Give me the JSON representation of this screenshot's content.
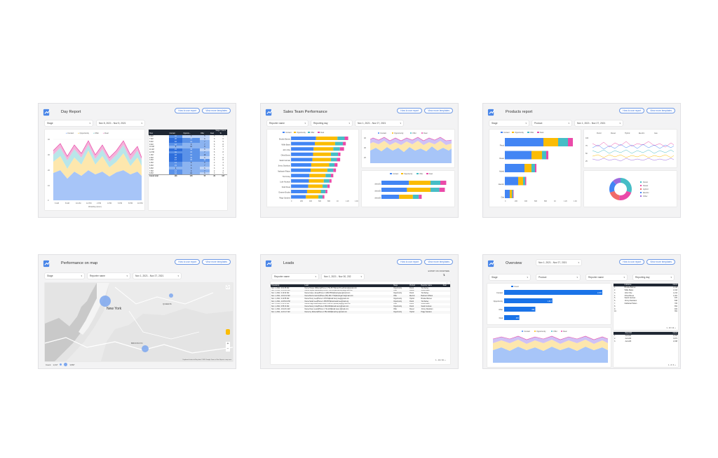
{
  "colors": {
    "contact": "#4285f4",
    "opportunity": "#fbbc04",
    "offer": "#46bdc6",
    "deal": "#ea4aa9",
    "dark_header": "#1f2733",
    "brand": "#3b73d8"
  },
  "common": {
    "how_to_use": "How to use report",
    "view_more": "View more templates"
  },
  "day_report": {
    "title": "Day Report",
    "stage": "Stage",
    "date_range": "Nov 8, 2021 - Nov 5, 2021",
    "legend": [
      "Contact",
      "Opportunity",
      "Offer",
      "Deal"
    ],
    "yticks": [
      "40",
      "30",
      "20",
      "10",
      "0"
    ],
    "xticks": [
      "6 AM",
      "8 AM",
      "10 AM",
      "12 PM",
      "2 PM",
      "4 PM",
      "6 PM",
      "8 PM",
      "10 PM"
    ],
    "xlabel": "Weekday (Hour)",
    "table_title": "Stage / Count",
    "headers": [
      "Hour",
      "Contact",
      "Opportu...",
      "Offer",
      "Deal",
      "To"
    ],
    "rows": [
      [
        "6 AM",
        "11",
        "3",
        "5",
        "3",
        "4"
      ],
      [
        "7 AM",
        "20",
        "14",
        "6",
        "3",
        "6"
      ],
      [
        "8 AM",
        "16",
        "14",
        "7",
        "5",
        "5"
      ],
      [
        "9 AM",
        "12",
        "8",
        "7",
        "5",
        "8"
      ],
      [
        "10 AM",
        "9",
        "10",
        "8",
        "4",
        "6"
      ],
      [
        "11 AM",
        "21",
        "11",
        "6",
        "6",
        "7"
      ],
      [
        "12 PM",
        "11",
        "15",
        "7",
        "5",
        "8"
      ],
      [
        "1 PM",
        "18",
        "12",
        "10",
        "6",
        "7"
      ],
      [
        "2 PM",
        "18",
        "11",
        "6",
        "5",
        "8"
      ],
      [
        "3 PM",
        "17",
        "15",
        "11",
        "4",
        "8"
      ],
      [
        "4 PM",
        "14",
        "8",
        "9",
        "2",
        "4"
      ],
      [
        "5 PM",
        "15",
        "9",
        "7",
        "3",
        "5"
      ],
      [
        "6 PM",
        "9",
        "8",
        "6",
        "3",
        "4"
      ],
      [
        "7 PM",
        "13",
        "9",
        "7",
        "2",
        "3"
      ],
      [
        "8 PM",
        "12",
        "10",
        "6",
        "3",
        "5"
      ]
    ],
    "total": [
      "Grand total",
      "138",
      "105",
      "55",
      "29",
      "447"
    ]
  },
  "sales_team": {
    "title": "Sales Team Performance",
    "filters": [
      "Reporter name",
      "Reporting day",
      "Nov 1, 2021 - Nov 27, 2021"
    ],
    "legend": [
      "Contact",
      "Opportunity",
      "Offer",
      "Deal"
    ],
    "names": [
      "Brooke Barnes",
      "Willie Bates",
      "John Chie",
      "Olivia Bones",
      "Sarah Gutman",
      "Jimmy Davidson",
      "Nathaniel Patten",
      "Tori Forley",
      "Luke Houston",
      "Noah Fleas",
      "Deanne Brooks",
      "Paige Sanders"
    ],
    "xticks": [
      "0",
      "200",
      "400",
      "600",
      "800",
      "1K",
      "1.2K",
      "1.4K"
    ],
    "line_yticks": [
      "40",
      "30",
      "20"
    ],
    "bar2_names": [
      "demo01",
      "demo02",
      "demo03"
    ]
  },
  "products": {
    "title": "Products report",
    "filters": [
      "Stage",
      "Product",
      "Nov 1, 2021 - Nov 27, 2021"
    ],
    "legend": [
      "Contact",
      "Opportunity",
      "Offer",
      "Deal"
    ],
    "names": [
      "Petrol",
      "Diesel",
      "Hybrid",
      "Electric",
      "Gas"
    ],
    "xticks": [
      "0",
      "200",
      "400",
      "600",
      "800",
      "1K",
      "1.2K",
      "1.4K"
    ],
    "line_legend": [
      "Petrol",
      "Diesel",
      "Hybrid",
      "Electric",
      "Gas"
    ],
    "line_yticks": [
      "100",
      "75",
      "50",
      "25"
    ],
    "donut_legend": [
      "Petrol",
      "Diesel",
      "Hybrid",
      "Electric",
      "Other"
    ]
  },
  "map_report": {
    "title": "Performance on map",
    "filters": [
      "Stage",
      "Reporter name",
      "Nov 1, 2021 - Nov 27, 2021"
    ],
    "labels": [
      "New York",
      "QUEENS",
      "BROOKLYN"
    ],
    "footer_count": "Count",
    "footer_range": "1,017",
    "footer_max": "3,897",
    "attribution": "Keyboard shortcuts   Map data ©2021 Google   Terms of Use   Report a map error"
  },
  "leads": {
    "title": "Leads",
    "filters": [
      "Reporter name",
      "Nov 1, 2021 - Nov 30, 202"
    ],
    "export_hint": "EXPORT CSV FROM HERE",
    "headers": [
      "Timestamp",
      "Lead",
      "Stage",
      "Product",
      "Reporter name",
      "Deal"
    ],
    "rows": [
      [
        "Nov 1, 2021, 9:01:35 AM",
        "Name:Harper Williams|Phone:1 752-5577|Email:hh.adrhams@gmail.com",
        "Opportunity",
        "Petrol",
        "Tod Farley",
        ""
      ],
      [
        "Nov 1, 2021, 10:18:20 AM",
        "Name:Sophie Alexander|Phone:1 584-215|Email:sophie@mail.com",
        "Offer",
        "Diesel",
        "Willie Bates",
        ""
      ],
      [
        "Nov 1, 2021, 9:10:32 AM",
        "Name:Grace Jones|Phone:1 4482-5551|Email:grace@mail.com",
        "Opportunity",
        "Petrol",
        "Tod Farley",
        ""
      ],
      [
        "Nov 1, 2021, 11:02:12 AM",
        "Name:Morris Garmin|Phone:(55) 481-7741|Email:garmin@mail.com",
        "Offer",
        "Electric",
        "Bachelor Wilson",
        ""
      ],
      [
        "Nov 1, 2021, 9:14:55 AM",
        "Name:Henry Lee|Phone:1 478-51|Email:henry.lee@gmail.com",
        "Opportunity",
        "Hybrid",
        "Brooke Barnes",
        ""
      ],
      [
        "Nov 1, 2021, 12:45:01 PM",
        "Name:Sarah Lee|Phone:1 458-557|Email:sarah.lee@mail.org",
        "Opportunity",
        "Petrol",
        "Tod Farley",
        ""
      ],
      [
        "Nov 1, 2021, 8:02:35 AM",
        "Name:Paige Matthews|Phone:1 584-117|Email:paige@mail.com",
        "Offer",
        "Petrol",
        "Willie Bates",
        ""
      ],
      [
        "Nov 1, 2021, 9:55:13 AM",
        "Name:Nancy Cole|Phone:1 884-6001|Email:nancy@mail.com",
        "Opportunity",
        "Petrol",
        "Sarah Gutman",
        ""
      ],
      [
        "Nov 1, 2021, 10:12:41 AM",
        "Name:Owen Lewis|Phone:1 711-222|Email:owen.l@mail.com",
        "Offer",
        "Diesel",
        "Jimmy Davidson",
        ""
      ],
      [
        "Nov 1, 2021, 11:31:17 AM",
        "Name:Ivy Roberts|Phone:1 552-4040|Email:ivy.r@mail.com",
        "Opportunity",
        "Hybrid",
        "Paige Sanders",
        ""
      ]
    ],
    "pagination": "1 - 10 / 16"
  },
  "overview": {
    "title": "Overview",
    "date_range": "Nov 1, 2021 - Nov 27, 2021",
    "filters": [
      "Stage",
      "Product",
      "Reporter name",
      "Reporting day"
    ],
    "bar_legend": "Count",
    "bar_names": [
      "Contact",
      "Opportunity",
      "Offer",
      "Deal"
    ],
    "bar_values": [
      "2,678",
      "1,317",
      "851",
      "415"
    ],
    "area_legend": [
      "Contact",
      "Opportunity",
      "Offer",
      "Deal"
    ],
    "t1_headers": [
      "Fullname",
      "Count"
    ],
    "t1_rows": [
      [
        "1.",
        "Brooke Barnes",
        "1,418"
      ],
      [
        "2.",
        "Willie Bates",
        "1,313"
      ],
      [
        "3.",
        "John Chie",
        "1,214"
      ],
      [
        "4.",
        "Olivia Bones",
        "1,021"
      ],
      [
        "5.",
        "Sarah Gutman",
        "970"
      ],
      [
        "6.",
        "Jimmy Davidson",
        "818"
      ],
      [
        "7.",
        "Nathaniel Patten",
        "706"
      ],
      [
        "8.",
        "",
        "654"
      ],
      [
        "9.",
        "",
        "402"
      ],
      [
        "10.",
        "",
        "391"
      ]
    ],
    "t1_pager": "1 - 10 / 12",
    "t2_headers": [
      "ReportId",
      "Count"
    ],
    "t2_rows": [
      [
        "1.",
        "demo01",
        "4,041"
      ],
      [
        "2.",
        "demo02",
        "3,971"
      ],
      [
        "3.",
        "demo03",
        "2,198"
      ]
    ],
    "t2_pager": "1 - 3 / 3"
  }
}
